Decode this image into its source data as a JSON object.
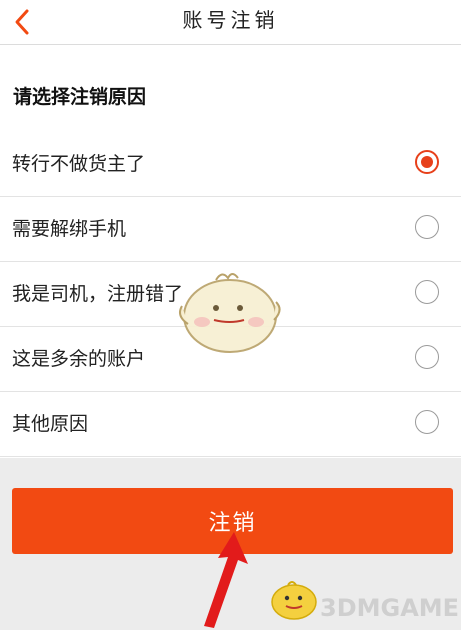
{
  "header": {
    "title": "账号注销",
    "back_icon": "chevron-left-icon"
  },
  "section": {
    "title": "请选择注销原因"
  },
  "reasons": [
    {
      "label": "转行不做货主了",
      "selected": true
    },
    {
      "label": "需要解绑手机",
      "selected": false
    },
    {
      "label": "我是司机，注册错了",
      "selected": false
    },
    {
      "label": "这是多余的账户",
      "selected": false
    },
    {
      "label": "其他原因",
      "selected": false
    }
  ],
  "submit": {
    "label": "注销"
  },
  "watermark": {
    "text": "3DMGAME"
  },
  "colors": {
    "accent": "#f24a12",
    "radio_selected": "#e7401a",
    "arrow": "#e21b1b"
  }
}
